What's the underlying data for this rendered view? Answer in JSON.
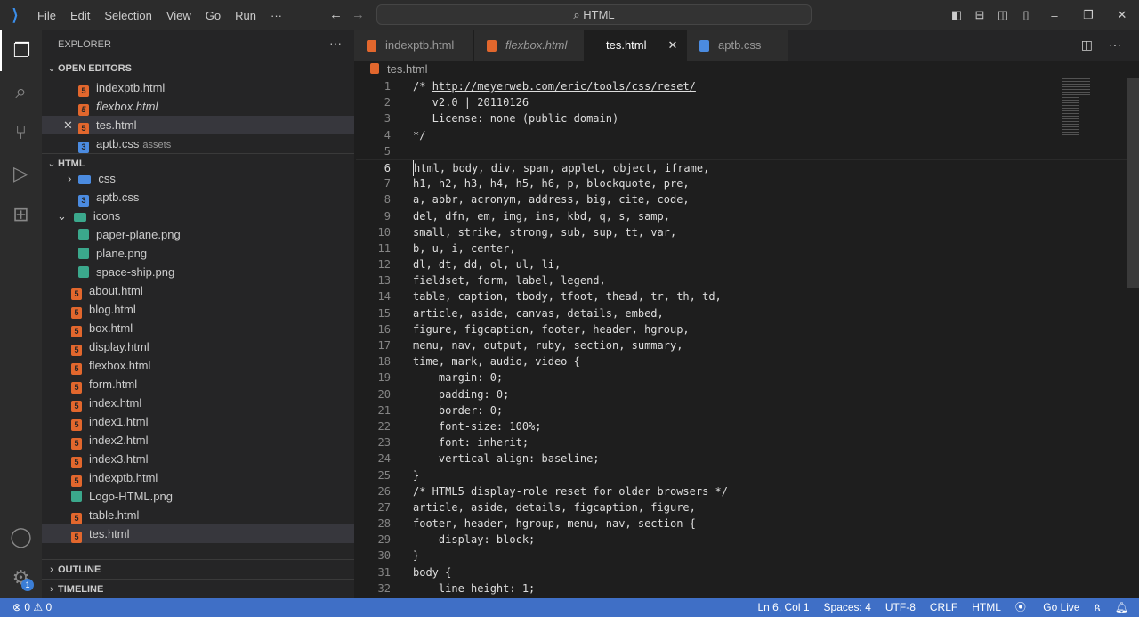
{
  "menu": [
    "File",
    "Edit",
    "Selection",
    "View",
    "Go",
    "Run",
    "···"
  ],
  "search": "⌕ HTML",
  "explorer": {
    "title": "EXPLORER",
    "open_editors": "OPEN EDITORS",
    "folder": "HTML",
    "outline": "OUTLINE",
    "timeline": "TIMELINE",
    "open": [
      {
        "name": "indexptb.html",
        "type": "html"
      },
      {
        "name": "flexbox.html",
        "type": "html",
        "italic": true
      },
      {
        "name": "tes.html",
        "type": "html"
      },
      {
        "name": "aptb.css",
        "type": "css",
        "desc": "assets"
      }
    ],
    "tree": [
      {
        "name": "css"
      },
      {
        "name": "aptb.css"
      },
      {
        "name": "icons"
      },
      {
        "name": "paper-plane.png"
      },
      {
        "name": "plane.png"
      },
      {
        "name": "space-ship.png"
      },
      {
        "name": "about.html"
      },
      {
        "name": "blog.html"
      },
      {
        "name": "box.html"
      },
      {
        "name": "display.html"
      },
      {
        "name": "flexbox.html"
      },
      {
        "name": "form.html"
      },
      {
        "name": "index.html"
      },
      {
        "name": "index1.html"
      },
      {
        "name": "index2.html"
      },
      {
        "name": "index3.html"
      },
      {
        "name": "indexptb.html"
      },
      {
        "name": "Logo-HTML.png"
      },
      {
        "name": "table.html"
      },
      {
        "name": "tes.html"
      }
    ]
  },
  "tabs": [
    "indexptb.html",
    "flexbox.html",
    "tes.html",
    "aptb.css"
  ],
  "breadcrumb": "tes.html",
  "code": [
    "/* http://meyerweb.com/eric/tools/css/reset/",
    "   v2.0 | 20110126",
    "   License: none (public domain)",
    "*/",
    "",
    "html, body, div, span, applet, object, iframe,",
    "h1, h2, h3, h4, h5, h6, p, blockquote, pre,",
    "a, abbr, acronym, address, big, cite, code,",
    "del, dfn, em, img, ins, kbd, q, s, samp,",
    "small, strike, strong, sub, sup, tt, var,",
    "b, u, i, center,",
    "dl, dt, dd, ol, ul, li,",
    "fieldset, form, label, legend,",
    "table, caption, tbody, tfoot, thead, tr, th, td,",
    "article, aside, canvas, details, embed,",
    "figure, figcaption, footer, header, hgroup,",
    "menu, nav, output, ruby, section, summary,",
    "time, mark, audio, video {",
    "    margin: 0;",
    "    padding: 0;",
    "    border: 0;",
    "    font-size: 100%;",
    "    font: inherit;",
    "    vertical-align: baseline;",
    "}",
    "/* HTML5 display-role reset for older browsers */",
    "article, aside, details, figcaption, figure,",
    "footer, header, hgroup, menu, nav, section {",
    "    display: block;",
    "}",
    "body {",
    "    line-height: 1;"
  ],
  "status": {
    "problems": "⊗ 0 ⚠ 0",
    "position": "Ln 6, Col 1",
    "spaces": "Spaces: 4",
    "encoding": "UTF-8",
    "eol": "CRLF",
    "language": "HTML",
    "golive": "Go Live"
  },
  "settings_badge": "1"
}
